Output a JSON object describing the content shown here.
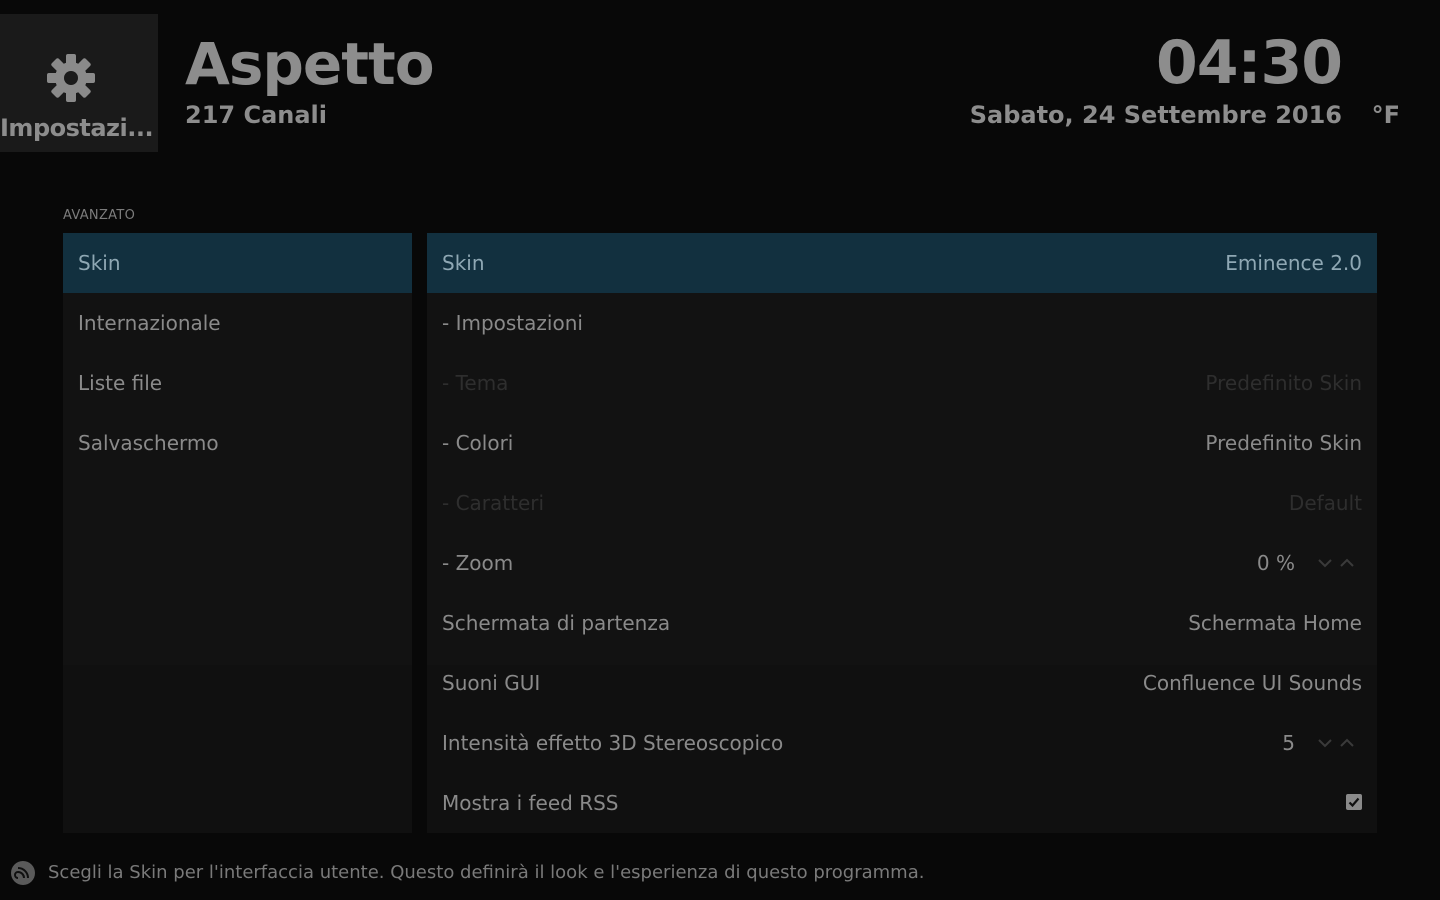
{
  "header": {
    "home_label": "Impostazi...",
    "title": "Aspetto",
    "subtitle": "217 Canali",
    "time": "04:30",
    "date": "Sabato, 24 Settembre 2016",
    "temperature": "°F"
  },
  "section": {
    "label": "AVANZATO"
  },
  "categories": [
    {
      "label": "Skin",
      "active": true
    },
    {
      "label": "Internazionale"
    },
    {
      "label": "Liste file"
    },
    {
      "label": "Salvaschermo"
    }
  ],
  "settings": [
    {
      "label": "Skin",
      "value": "Eminence 2.0",
      "state": "active"
    },
    {
      "label": "- Impostazioni",
      "value": ""
    },
    {
      "label": "- Tema",
      "value": "Predefinito Skin",
      "state": "disabled"
    },
    {
      "label": "- Colori",
      "value": "Predefinito Skin"
    },
    {
      "label": "- Caratteri",
      "value": "Default",
      "state": "disabled"
    },
    {
      "label": "- Zoom",
      "value": "0 %",
      "control": "spinner"
    },
    {
      "label": "Schermata di partenza",
      "value": "Schermata Home"
    },
    {
      "label": "Suoni GUI",
      "value": "Confluence UI Sounds"
    },
    {
      "label": "Intensità effetto 3D Stereoscopico",
      "value": "5",
      "control": "spinner"
    },
    {
      "label": "Mostra i feed RSS",
      "value": "",
      "control": "checkbox",
      "checked": true
    }
  ],
  "footer": {
    "description": "Scegli la Skin per l'interfaccia utente. Questo definirà il look e l'esperienza di questo programma."
  },
  "colors": {
    "background": "#080808",
    "highlight": "#12303f",
    "text": "#8a8a8a",
    "disabled_text": "#2e2e2e"
  },
  "icons": {
    "home": "gear-icon",
    "footer": "info-icon",
    "spinner": [
      "chevron-down-icon",
      "chevron-up-icon"
    ],
    "checkbox": "checkbox-checked-icon"
  }
}
